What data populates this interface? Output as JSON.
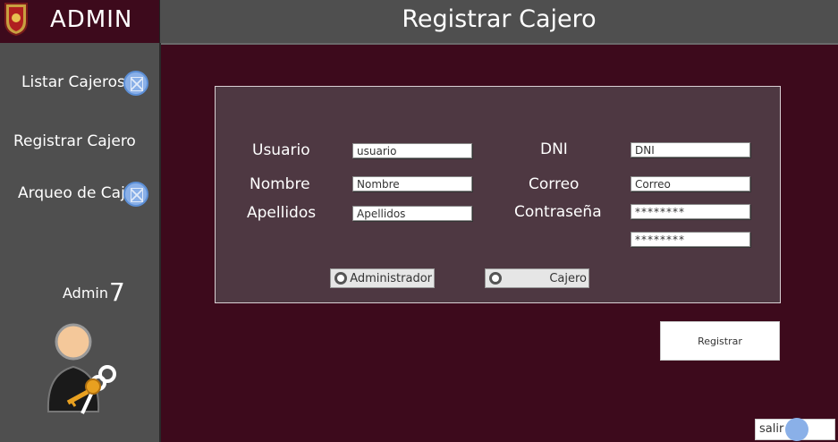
{
  "header": {
    "brand": "ADMIN",
    "title": "Registrar Cajero"
  },
  "sidebar": {
    "items": [
      {
        "label": "Listar Cajeros"
      },
      {
        "label": "Registrar Cajero"
      },
      {
        "label": "Arqueo de Caja"
      }
    ],
    "admin_label": "Admin",
    "admin_number": "7"
  },
  "form": {
    "usuario_label": "Usuario",
    "usuario_value": "usuario",
    "nombre_label": "Nombre",
    "nombre_value": "Nombre",
    "apellidos_label": "Apellidos",
    "apellidos_value": "Apellidos",
    "dni_label": "DNI",
    "dni_value": "DNI",
    "correo_label": "Correo",
    "correo_value": "Correo",
    "password_label": "Contraseña",
    "password_value": "********",
    "password_confirm_value": "********",
    "role_admin_label": "Administrador",
    "role_cajero_label": "Cajero"
  },
  "actions": {
    "register_label": "Registrar",
    "exit_label": "salir"
  },
  "colors": {
    "background": "#3d0a1c",
    "sidebar": "#4f4f4f",
    "panel": "#4e3842",
    "accent": "#8ab0e8"
  }
}
